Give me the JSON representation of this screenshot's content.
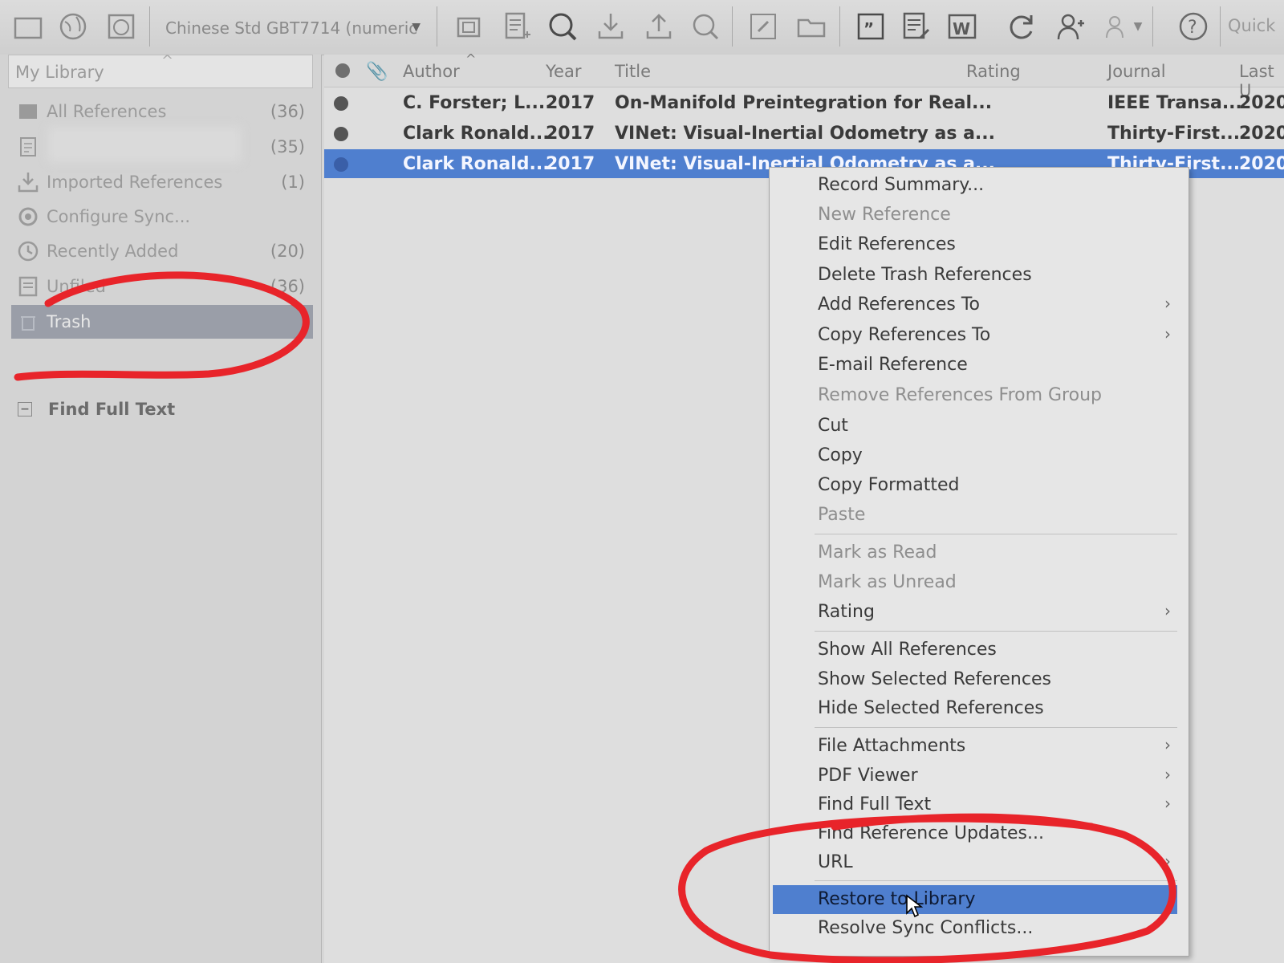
{
  "toolbar": {
    "style_select": "Chinese Std GBT7714 (numeric",
    "quick_search": "Quick",
    "icons": [
      "folder-icon",
      "globe-icon",
      "globe-folder-icon",
      "copy-icon",
      "new-reference-icon",
      "online-search-icon",
      "import-icon",
      "export-icon",
      "find-fulltext-icon",
      "link-icon",
      "open-folder-icon",
      "insert-citation-icon",
      "format-bibliography-icon",
      "word-icon",
      "sync-icon",
      "share-library-icon",
      "group-icon",
      "help-icon"
    ]
  },
  "sidebar": {
    "header": "My Library",
    "items": [
      {
        "label": "All References",
        "count": "(36)"
      },
      {
        "label": "",
        "count": "(35)"
      },
      {
        "label": "Imported References",
        "count": "(1)"
      },
      {
        "label": "Configure Sync...",
        "count": ""
      },
      {
        "label": "Recently Added",
        "count": "(20)"
      },
      {
        "label": "Unfiled",
        "count": "(36)"
      },
      {
        "label": "Trash",
        "count": ""
      }
    ],
    "find_full_text": "Find Full Text"
  },
  "columns": {
    "author": "Author",
    "year": "Year",
    "title": "Title",
    "rating": "Rating",
    "journal": "Journal",
    "last": "Last U"
  },
  "references": [
    {
      "author": "C. Forster; L....",
      "year": "2017",
      "title": "On-Manifold Preintegration for Real...",
      "journal": "IEEE Transa...",
      "last": "2020"
    },
    {
      "author": "Clark Ronald...",
      "year": "2017",
      "title": "VINet: Visual-Inertial Odometry as a...",
      "journal": "Thirty-First...",
      "last": "2020"
    },
    {
      "author": "Clark Ronald...",
      "year": "2017",
      "title": "VINet: Visual-Inertial Odometry as a...",
      "journal": "Thirty-First...",
      "last": "2020"
    }
  ],
  "context_menu": {
    "items": [
      "Record Summary...",
      "New Reference",
      "Edit References",
      "Delete Trash References",
      "Add References To",
      "Copy References To",
      "E-mail Reference",
      "Remove References From Group",
      "Cut",
      "Copy",
      "Copy Formatted",
      "Paste",
      "Mark as Read",
      "Mark as Unread",
      "Rating",
      "Show All References",
      "Show Selected References",
      "Hide Selected References",
      "File Attachments",
      "PDF Viewer",
      "Find Full Text",
      "Find Reference Updates...",
      "URL",
      "Restore to Library",
      "Resolve Sync Conflicts..."
    ],
    "highlighted": "Restore to Library"
  },
  "colors": {
    "selection": "#4f7fcf",
    "annotation": "#e8242a"
  }
}
